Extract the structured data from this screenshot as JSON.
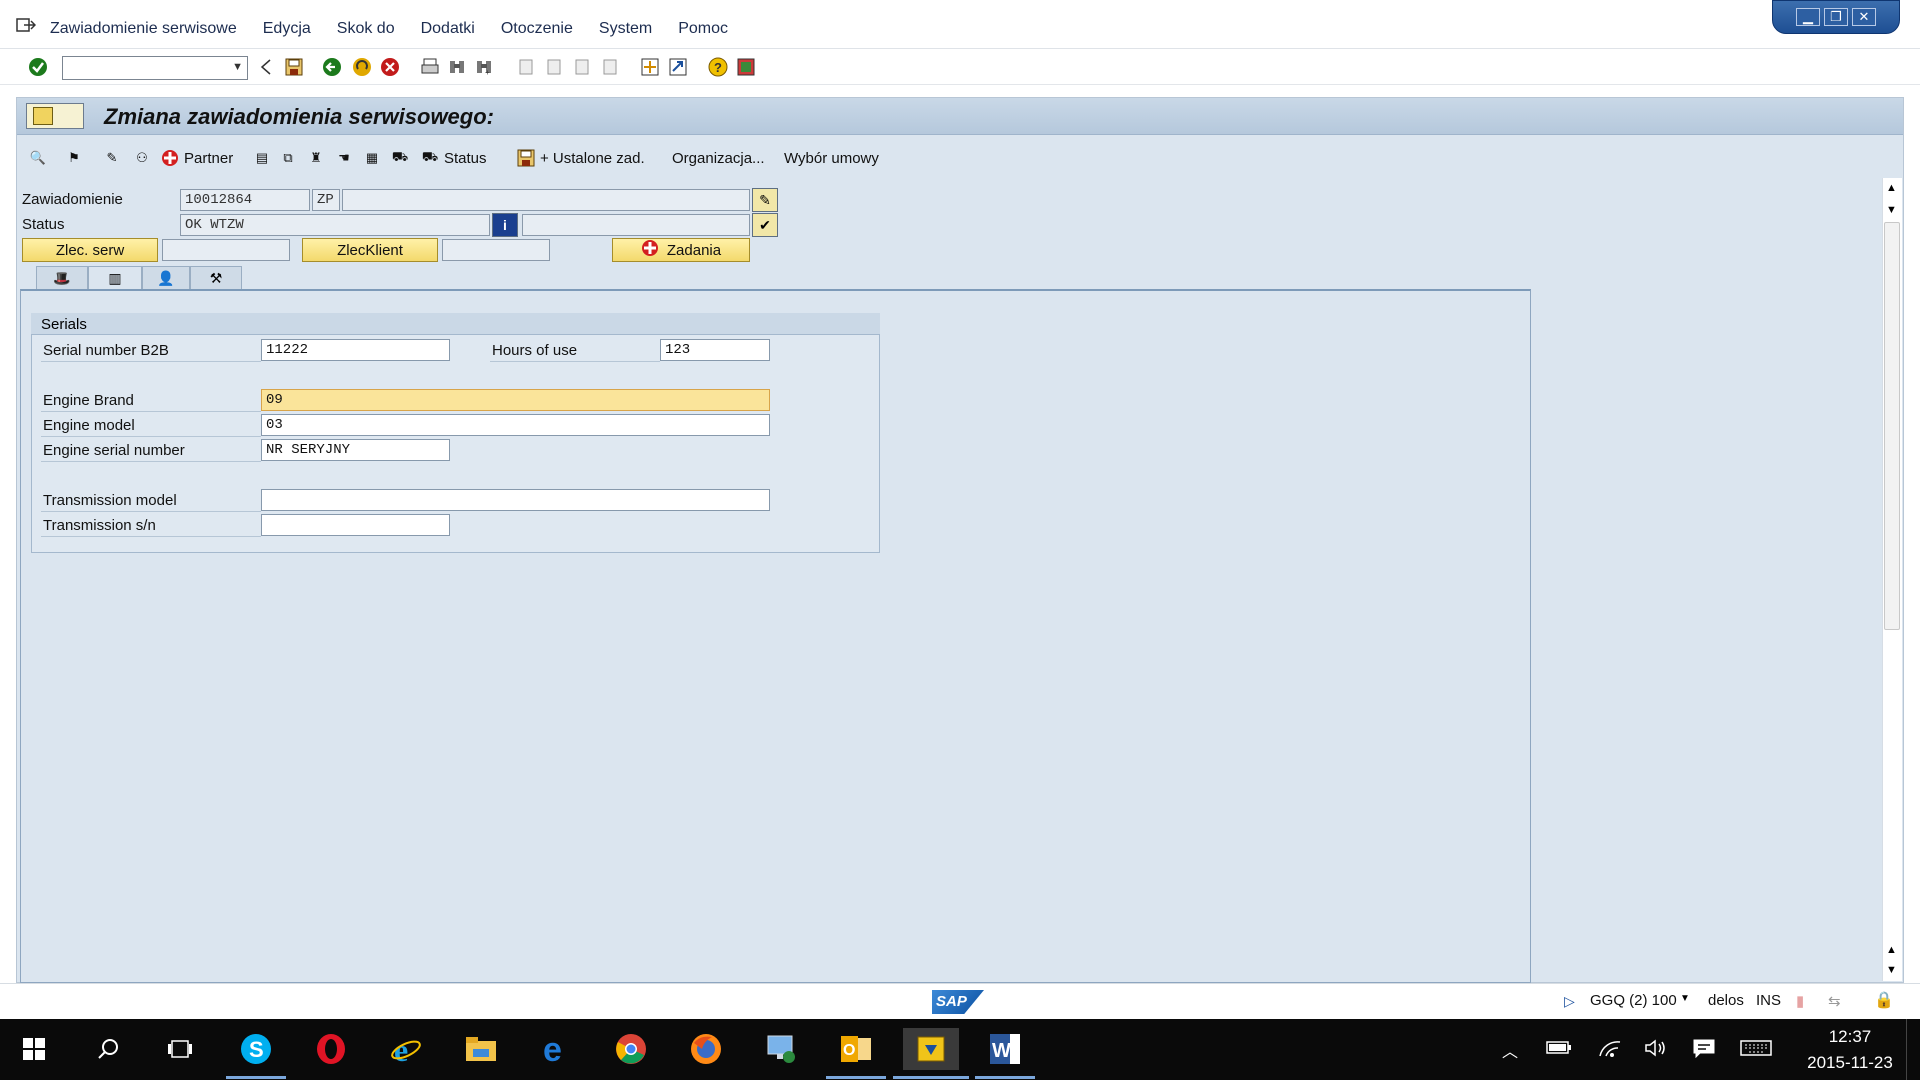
{
  "menu": {
    "items": [
      "Zawiadomienie serwisowe",
      "Edycja",
      "Skok do",
      "Dodatki",
      "Otoczenie",
      "System",
      "Pomoc"
    ]
  },
  "window_controls": [
    "minimize",
    "restore",
    "close"
  ],
  "title": "Zmiana zawiadomienia serwisowego:",
  "app_toolbar": {
    "partner": "Partner",
    "status": "Status",
    "ustalone": "+ Ustalone zad.",
    "organizacja": "Organizacja...",
    "wybor": "Wybór umowy"
  },
  "header": {
    "zawiadomienie_label": "Zawiadomienie",
    "zawiadomienie_value": "10012864",
    "zawiadomienie_type": "ZP",
    "status_label": "Status",
    "status_value": "OK  WTZW",
    "zlec_serw": "Zlec. serw",
    "zlec_klient": "ZlecKlient",
    "zadania": "Zadania"
  },
  "group": {
    "title": "Serials",
    "serial_b2b_label": "Serial number B2B",
    "serial_b2b_value": "11222",
    "hours_label": "Hours of use",
    "hours_value": "123",
    "engine_brand_label": "Engine Brand",
    "engine_brand_value": "09",
    "engine_model_label": "Engine model",
    "engine_model_value": "03",
    "engine_serial_label": "Engine serial number",
    "engine_serial_value": "NR SERYJNY",
    "transmission_model_label": "Transmission model",
    "transmission_model_value": "",
    "transmission_sn_label": "Transmission s/n",
    "transmission_sn_value": ""
  },
  "statusbar": {
    "system": "GGQ (2) 100",
    "host": "delos",
    "mode": "INS",
    "logo": "SAP"
  },
  "taskbar": {
    "time": "12:37",
    "date": "2015-11-23"
  },
  "colors": {
    "sap_blue_bg": "#dbe5ef",
    "yellow_button": "#f3d96c",
    "active_field": "#fae49a",
    "taskbar": "#0a0a0a"
  }
}
